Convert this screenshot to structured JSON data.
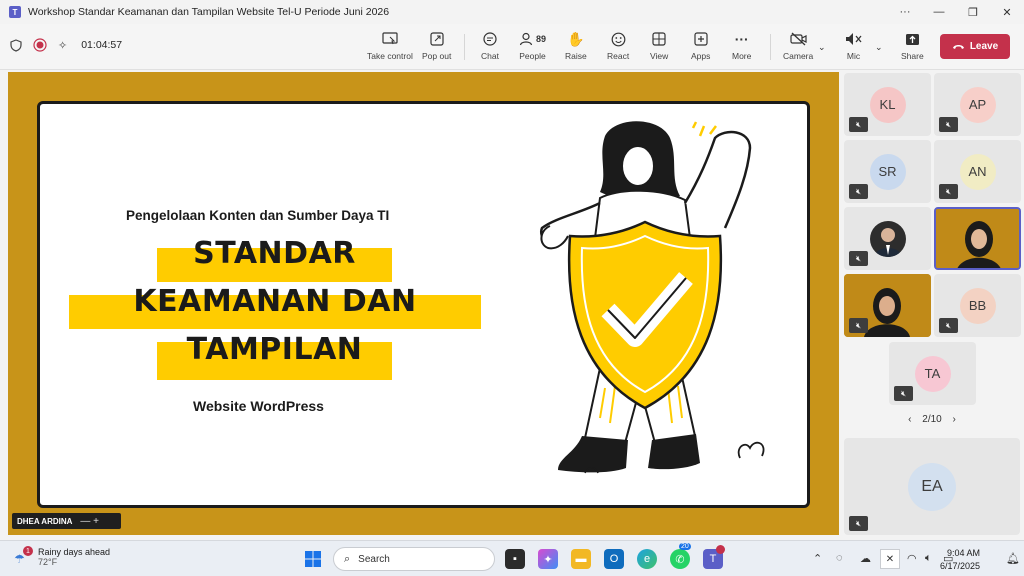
{
  "window": {
    "title": "Workshop Standar Keamanan dan Tampilan Website Tel-U Periode Juni 2026",
    "controls": [
      "···",
      "—",
      "❐",
      "✕"
    ]
  },
  "toolbar": {
    "timer": "01:04:57",
    "buttons": {
      "take_control": "Take control",
      "pop_out": "Pop out",
      "chat": "Chat",
      "people": "People",
      "people_count": "89",
      "raise": "Raise",
      "react": "React",
      "view": "View",
      "apps": "Apps",
      "more": "More",
      "camera": "Camera",
      "mic": "Mic",
      "share": "Share",
      "leave": "Leave"
    }
  },
  "slide": {
    "subtitle": "Pengelolaan Konten dan Sumber Daya TI",
    "title_lines": [
      "STANDAR",
      "KEAMANAN DAN",
      "TAMPILAN"
    ],
    "footer": "Website WordPress",
    "presenter": "DHEA ARDINA"
  },
  "participants": [
    {
      "initials": "KL",
      "color": "#f5c6c6"
    },
    {
      "initials": "AP",
      "color": "#f7cfc9"
    },
    {
      "initials": "SR",
      "color": "#c9d9ee"
    },
    {
      "initials": "AN",
      "color": "#f1ecc4"
    },
    {
      "initials": "",
      "color": "#dcdcdc"
    },
    {
      "initials": "",
      "color": "#c08a18"
    },
    {
      "initials": "",
      "color": "#c08a18"
    },
    {
      "initials": "BB",
      "color": "#f3d2c3"
    },
    {
      "initials": "TA",
      "color": "#f7c7d3"
    },
    {
      "initials": "EA",
      "color": "#d3e0ef"
    }
  ],
  "pager": {
    "prev": "‹",
    "label": "2/10",
    "next": "›"
  },
  "taskbar": {
    "weather_title": "Rainy days ahead",
    "weather_temp": "72°F",
    "weather_badge": "1",
    "search_placeholder": "Search",
    "whatsapp_badge": "20",
    "time": "9:04 AM",
    "date": "6/17/2025"
  }
}
